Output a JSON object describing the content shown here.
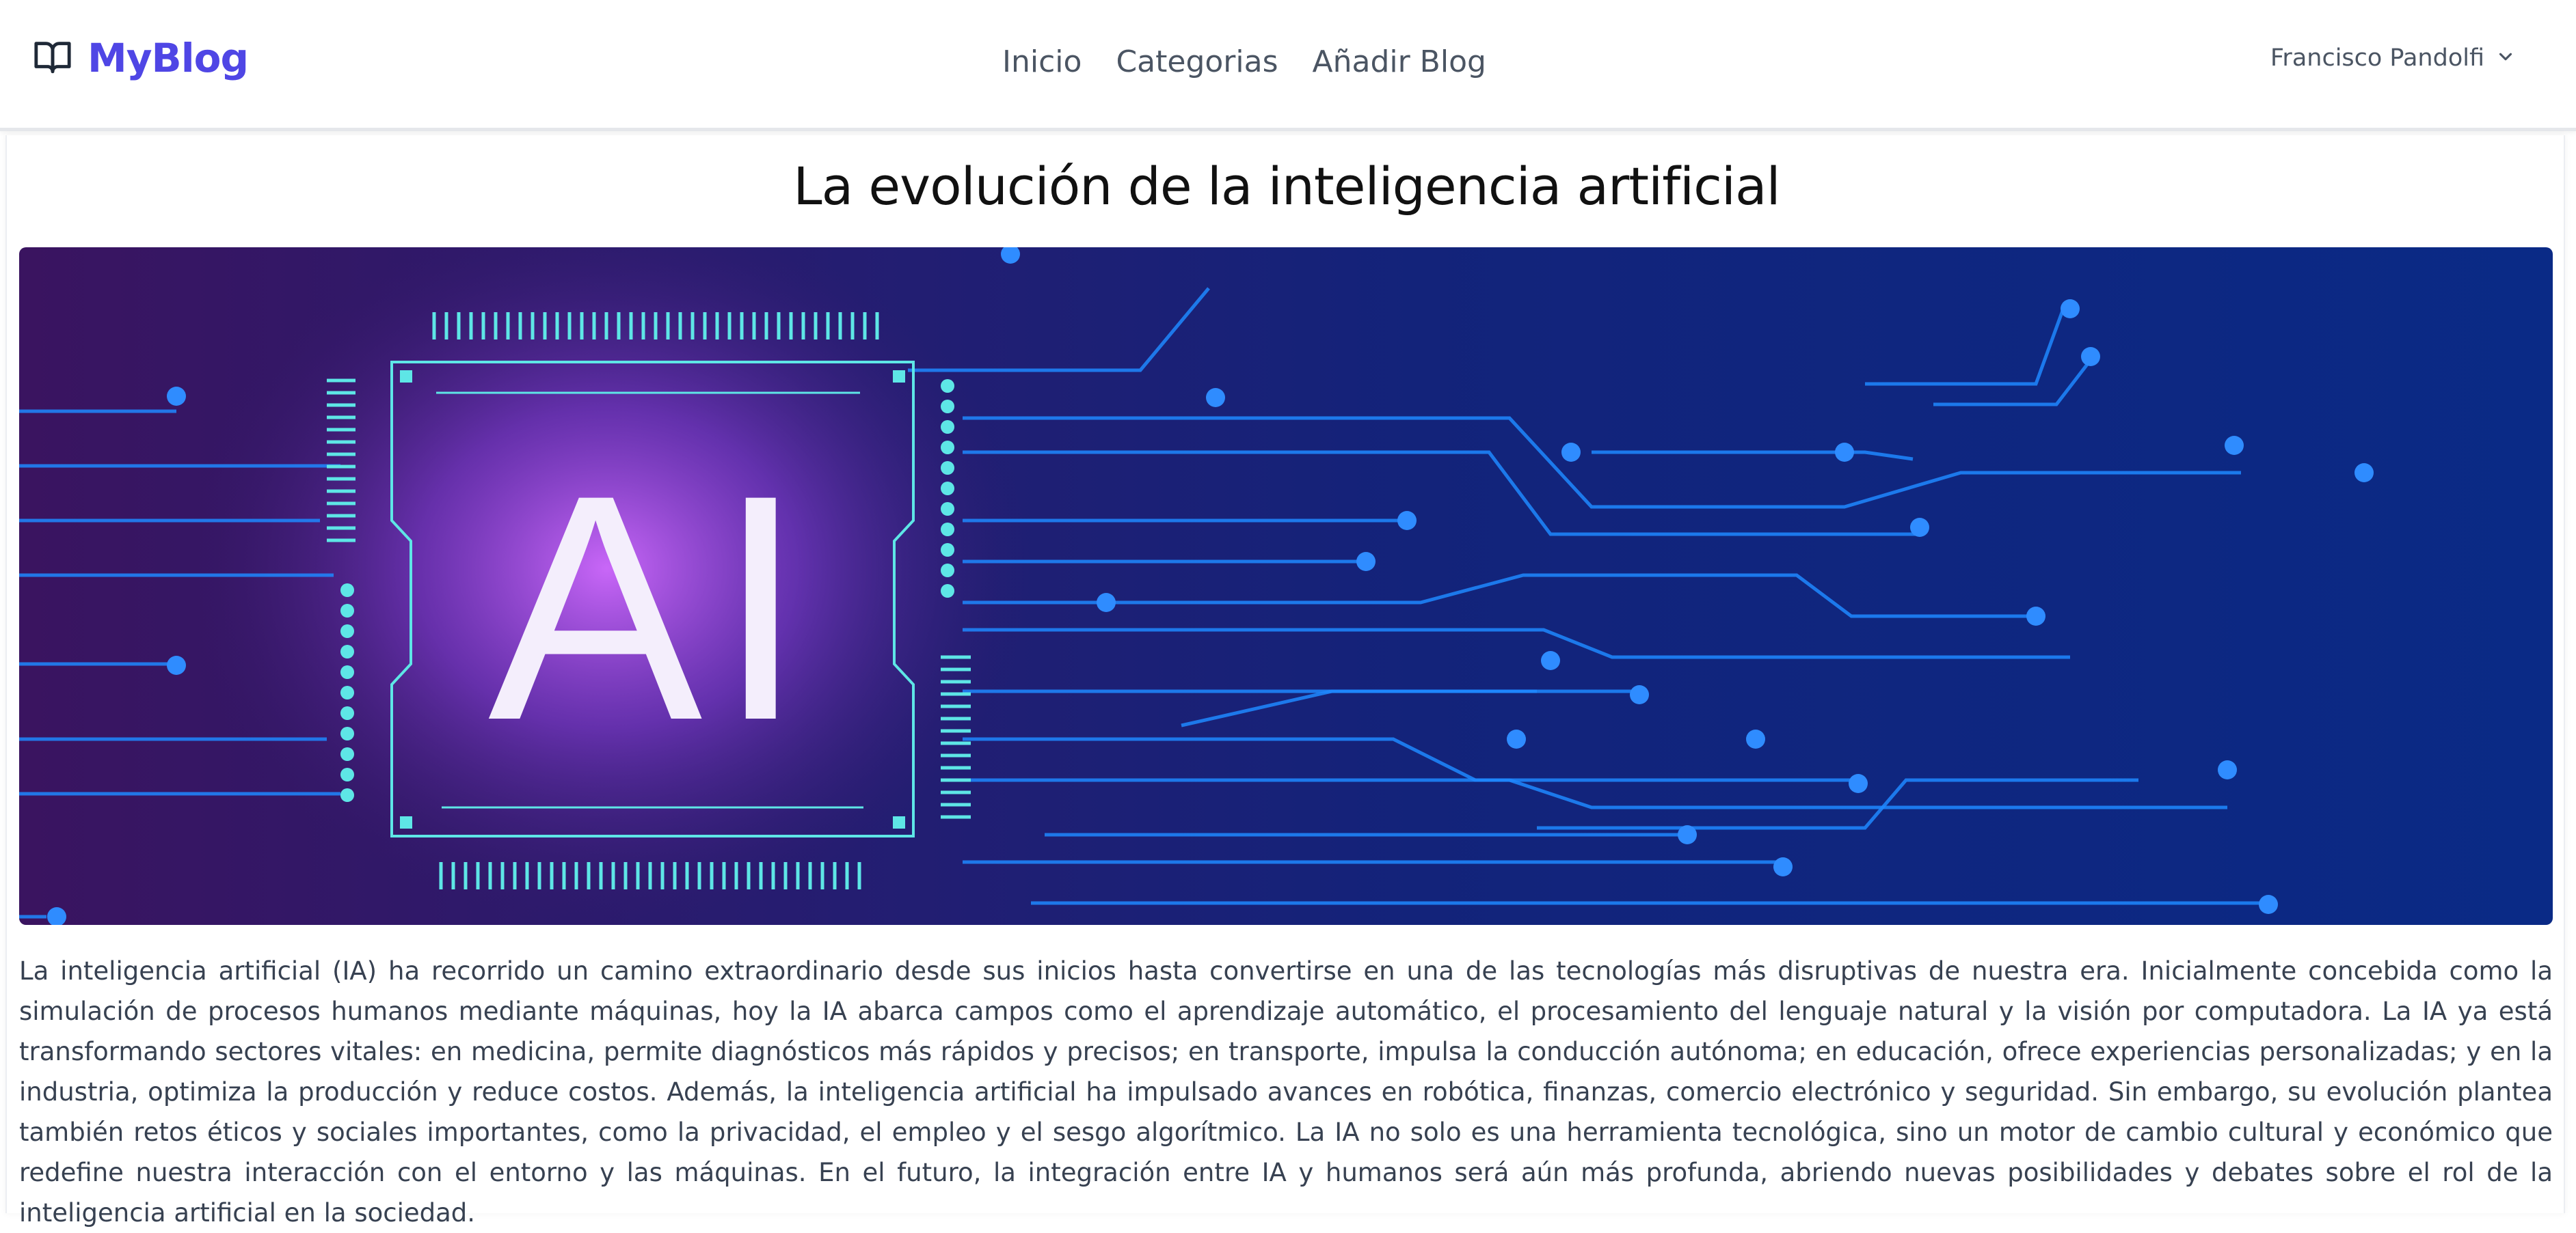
{
  "navbar": {
    "brand": "MyBlog",
    "brand_icon": "book-icon",
    "links": [
      {
        "label": "Inicio"
      },
      {
        "label": "Categorias"
      },
      {
        "label": "Añadir Blog"
      }
    ],
    "user": {
      "name": "Francisco Pandolfi",
      "icon": "chevron-down-icon"
    }
  },
  "post": {
    "title": "La evolución de la inteligencia artificial",
    "image": {
      "label": "AI"
    },
    "body": "La inteligencia artificial (IA) ha recorrido un camino extraordinario desde sus inicios hasta convertirse en una de las tecnologías más disruptivas de nuestra era. Inicialmente concebida como la simulación de procesos humanos mediante máquinas, hoy la IA abarca campos como el aprendizaje automático, el procesamiento del lenguaje natural y la visión por computadora. La IA ya está transformando sectores vitales: en medicina, permite diagnósticos más rápidos y precisos; en transporte, impulsa la conducción autónoma; en educación, ofrece experiencias personalizadas; y en la industria, optimiza la producción y reduce costos. Además, la inteligencia artificial ha impulsado avances en robótica, finanzas, comercio electrónico y seguridad. Sin embargo, su evolución plantea también retos éticos y sociales importantes, como la privacidad, el empleo y el sesgo algorítmico. La IA no solo es una herramienta tecnológica, sino un motor de cambio cultural y económico que redefine nuestra interacción con el entorno y las máquinas. En el futuro, la integración entre IA y humanos será aún más profunda, abriendo nuevas posibilidades y debates sobre el rol de la inteligencia artificial en la sociedad."
  },
  "colors": {
    "brand": "#4f46e5",
    "nav_text": "#4b5563",
    "body_text": "#374151",
    "circuit": "#1e88ff",
    "chip": "#5ee6e6"
  }
}
